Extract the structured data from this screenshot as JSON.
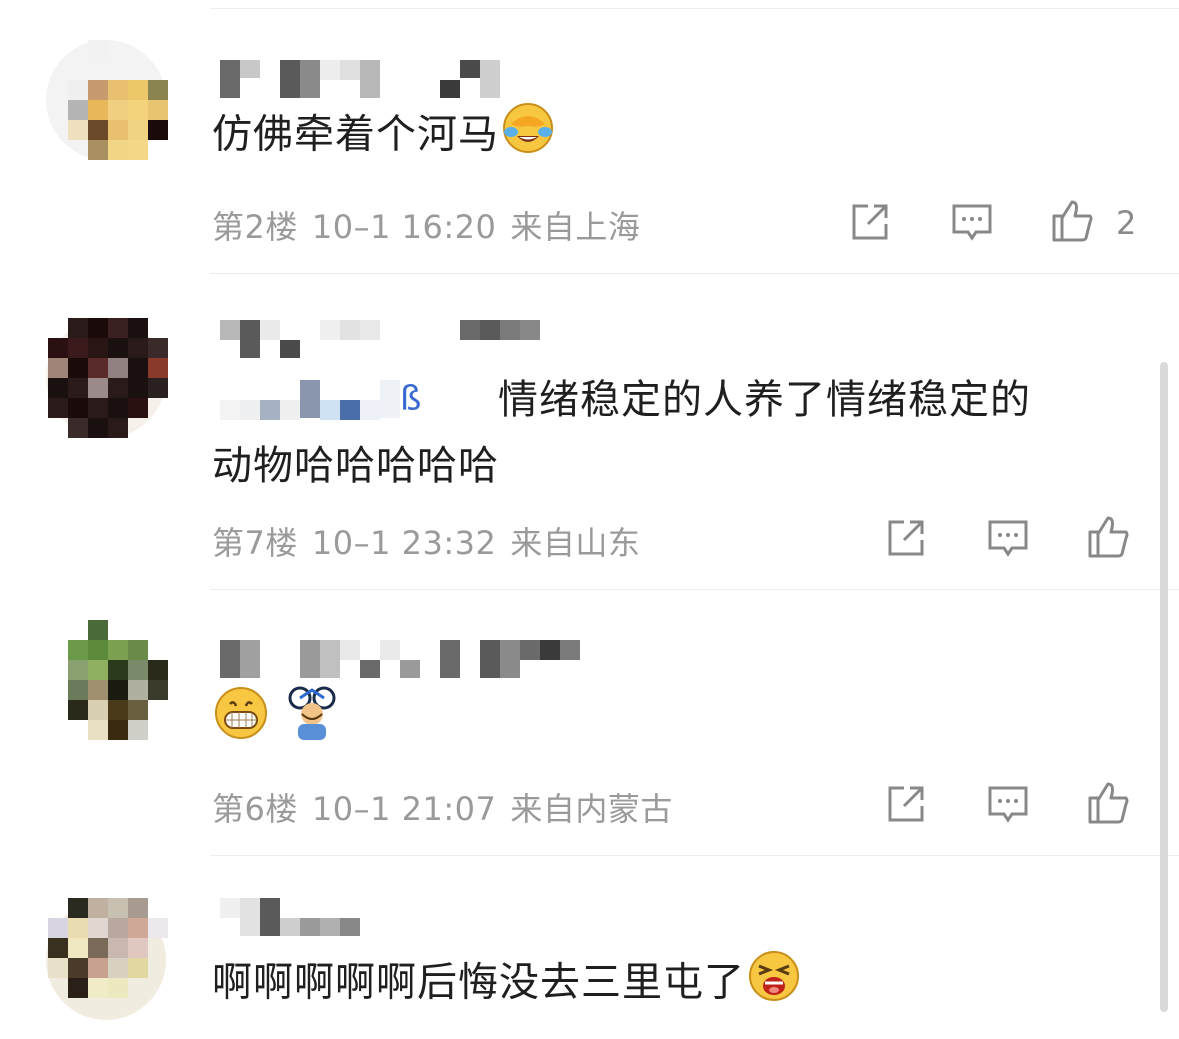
{
  "comments": [
    {
      "text": "仿佛牵着个河马",
      "floor": "第2楼",
      "date": "10–1 16:20",
      "location": "来自上海",
      "likes": "2",
      "emoji": "laugh-cry-facepalm-emoji"
    },
    {
      "text": "情绪稳定的人养了情绪稳定的",
      "text2": "动物哈哈哈哈哈",
      "floor": "第7楼",
      "date": "10–1 23:32",
      "location": "来自山东",
      "likes": ""
    },
    {
      "text": "",
      "floor": "第6楼",
      "date": "10–1 21:07",
      "location": "来自内蒙古",
      "likes": "",
      "emoji": "grin-emoji"
    },
    {
      "text": "啊啊啊啊啊后悔没去三里屯了",
      "emoji": "crying-loud-emoji"
    }
  ],
  "icons": {
    "repost": "repost-icon",
    "comment": "comment-icon",
    "like": "thumbs-up-icon"
  },
  "colors": {
    "text": "#1f1f1f",
    "meta": "#9a9a9a",
    "divider": "#ececec"
  }
}
